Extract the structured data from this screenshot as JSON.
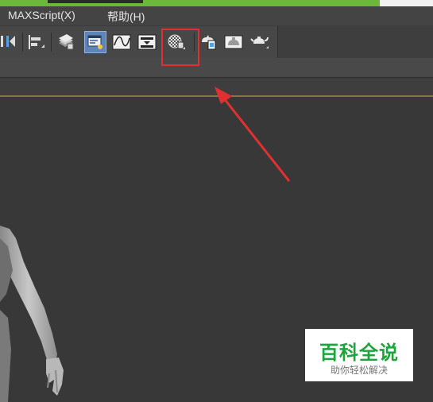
{
  "menubar": {
    "items": [
      {
        "label": "MAXScript(X)"
      },
      {
        "label": "帮助(H)"
      }
    ]
  },
  "toolbar": {
    "icons": [
      "align-icon",
      "align-left-icon",
      "layer-manager-icon",
      "scene-explorer-icon",
      "curve-editor-icon",
      "schematic-view-icon",
      "material-editor-icon",
      "render-setup-icon",
      "rendered-frame-window-icon",
      "render-production-icon"
    ],
    "highlighted": "material-editor-icon"
  },
  "annotation": {
    "highlight_color": "#e23030",
    "arrow_color": "#e23030"
  },
  "watermark": {
    "title": "百科全说",
    "subtitle": "助你轻松解决",
    "title_color": "#1fa33c"
  }
}
